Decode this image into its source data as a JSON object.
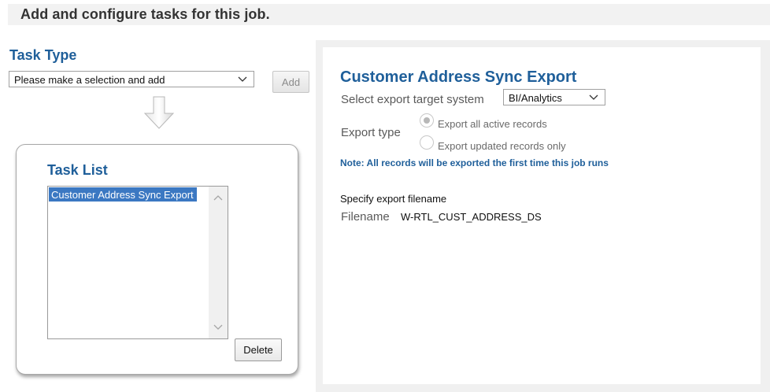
{
  "header": {
    "title": "Add and configure tasks for this job."
  },
  "task_type": {
    "label": "Task Type",
    "select_value": "Please make a selection and add",
    "add_label": "Add"
  },
  "task_list": {
    "label": "Task List",
    "items": [
      "Customer Address Sync Export"
    ],
    "selected_index": 0,
    "delete_label": "Delete"
  },
  "task_config": {
    "title": "Customer Address Sync Export",
    "target_label": "Select export target system",
    "target_value": "BI/Analytics",
    "export_type_label": "Export type",
    "options": [
      {
        "label": "Export all active records",
        "checked": true
      },
      {
        "label": "Export updated records only",
        "checked": false
      }
    ],
    "note": "Note: All records will be exported the first time this job runs",
    "specify_label": "Specify export filename",
    "filename_label": "Filename",
    "filename_value": "W-RTL_CUST_ADDRESS_DS"
  },
  "icons": {
    "select_chevron": "chevron-down-icon",
    "flow_arrow": "arrow-down-icon",
    "scroll_up": "chevron-up-icon",
    "scroll_down": "chevron-down-icon"
  },
  "colors": {
    "accent_blue": "#1f5f9a",
    "selection_blue": "#3b78c2"
  }
}
